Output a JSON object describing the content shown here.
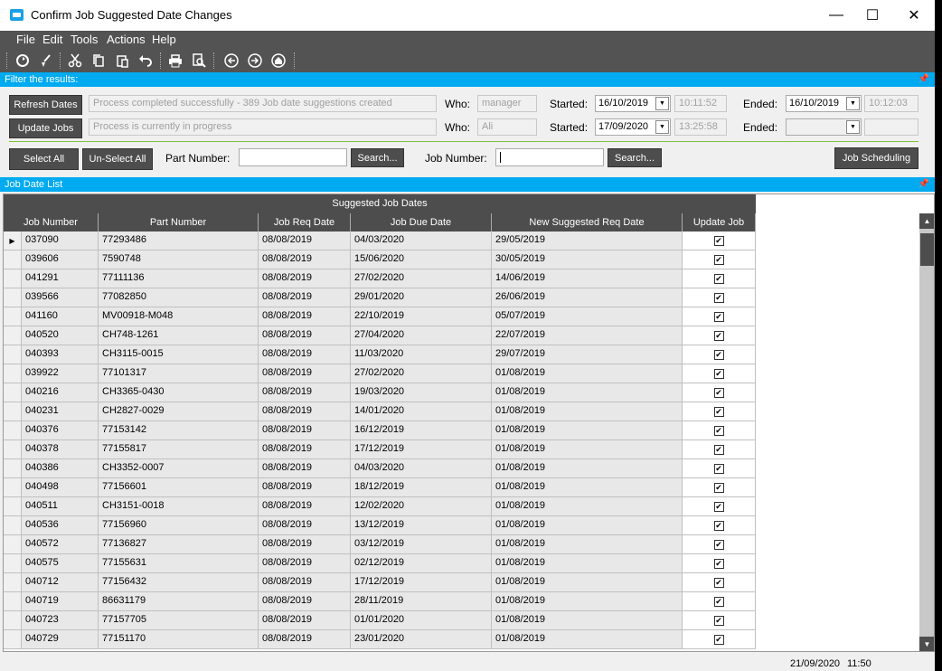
{
  "window": {
    "title": "Confirm Job Suggested Date Changes",
    "minimize": "—",
    "maximize": "☐",
    "close": "✕"
  },
  "menu": [
    "File",
    "Edit",
    "Tools",
    "Actions",
    "Help"
  ],
  "toolbar_icons": [
    "refresh-icon",
    "brush-icon",
    "cut-icon",
    "copy-icon",
    "paste-icon",
    "undo-icon",
    "print-icon",
    "print-preview-icon",
    "back-icon",
    "forward-icon",
    "home-icon"
  ],
  "filter": {
    "header": "Filter the results:",
    "refresh_label": "Refresh Dates",
    "refresh_status": "Process completed successfully - 389 Job date suggestions created",
    "who_label": "Who:",
    "refresh_who": "manager",
    "started_label": "Started:",
    "refresh_started_date": "16/10/2019",
    "refresh_started_time": "10:11:52",
    "ended_label": "Ended:",
    "refresh_ended_date": "16/10/2019",
    "refresh_ended_time": "10:12:03",
    "update_label": "Update Jobs",
    "update_status": "Process is currently in progress",
    "update_who": "Ali",
    "update_started_date": "17/09/2020",
    "update_started_time": "13:25:58",
    "update_ended_date": "",
    "update_ended_time": "",
    "select_all": "Select All",
    "unselect_all": "Un-Select All",
    "part_number_label": "Part Number:",
    "part_number_value": "",
    "search1": "Search...",
    "job_number_label": "Job Number:",
    "job_number_value": "",
    "search2": "Search...",
    "job_scheduling": "Job Scheduling"
  },
  "grid": {
    "header": "Job Date List",
    "band": "Suggested Job Dates",
    "columns": [
      "Job Number",
      "Part Number",
      "Job Req Date",
      "Job Due Date",
      "New Suggested Req Date",
      "Update Job"
    ],
    "rows": [
      [
        "037090",
        "77293486",
        "08/08/2019",
        "04/03/2020",
        "29/05/2019",
        true
      ],
      [
        "039606",
        "7590748",
        "08/08/2019",
        "15/06/2020",
        "30/05/2019",
        true
      ],
      [
        "041291",
        "77111136",
        "08/08/2019",
        "27/02/2020",
        "14/06/2019",
        true
      ],
      [
        "039566",
        "77082850",
        "08/08/2019",
        "29/01/2020",
        "26/06/2019",
        true
      ],
      [
        "041160",
        "MV00918-M048",
        "08/08/2019",
        "22/10/2019",
        "05/07/2019",
        true
      ],
      [
        "040520",
        "CH748-1261",
        "08/08/2019",
        "27/04/2020",
        "22/07/2019",
        true
      ],
      [
        "040393",
        "CH3115-0015",
        "08/08/2019",
        "11/03/2020",
        "29/07/2019",
        true
      ],
      [
        "039922",
        "77101317",
        "08/08/2019",
        "27/02/2020",
        "01/08/2019",
        true
      ],
      [
        "040216",
        "CH3365-0430",
        "08/08/2019",
        "19/03/2020",
        "01/08/2019",
        true
      ],
      [
        "040231",
        "CH2827-0029",
        "08/08/2019",
        "14/01/2020",
        "01/08/2019",
        true
      ],
      [
        "040376",
        "77153142",
        "08/08/2019",
        "16/12/2019",
        "01/08/2019",
        true
      ],
      [
        "040378",
        "77155817",
        "08/08/2019",
        "17/12/2019",
        "01/08/2019",
        true
      ],
      [
        "040386",
        "CH3352-0007",
        "08/08/2019",
        "04/03/2020",
        "01/08/2019",
        true
      ],
      [
        "040498",
        "77156601",
        "08/08/2019",
        "18/12/2019",
        "01/08/2019",
        true
      ],
      [
        "040511",
        "CH3151-0018",
        "08/08/2019",
        "12/02/2020",
        "01/08/2019",
        true
      ],
      [
        "040536",
        "77156960",
        "08/08/2019",
        "13/12/2019",
        "01/08/2019",
        true
      ],
      [
        "040572",
        "77136827",
        "08/08/2019",
        "03/12/2019",
        "01/08/2019",
        true
      ],
      [
        "040575",
        "77155631",
        "08/08/2019",
        "02/12/2019",
        "01/08/2019",
        true
      ],
      [
        "040712",
        "77156432",
        "08/08/2019",
        "17/12/2019",
        "01/08/2019",
        true
      ],
      [
        "040719",
        "86631179",
        "08/08/2019",
        "28/11/2019",
        "01/08/2019",
        true
      ],
      [
        "040723",
        "77157705",
        "08/08/2019",
        "01/01/2020",
        "01/08/2019",
        true
      ],
      [
        "040729",
        "77151170",
        "08/08/2019",
        "23/01/2020",
        "01/08/2019",
        true
      ]
    ]
  },
  "status": {
    "date": "21/09/2020",
    "time": "11:50"
  }
}
